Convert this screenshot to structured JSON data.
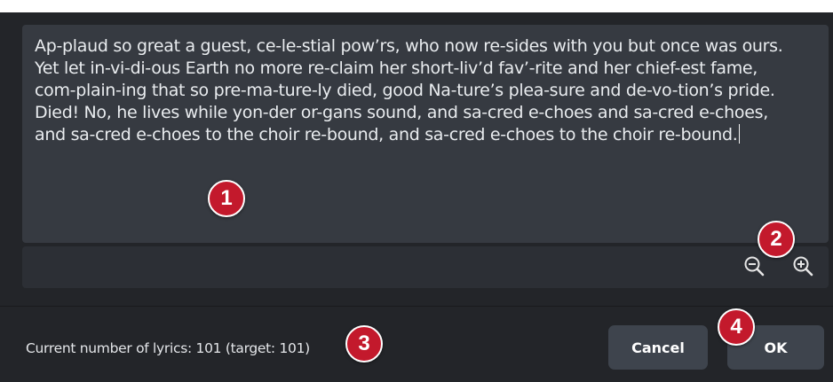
{
  "lyrics_editor": {
    "text": "Ap-plaud so great a guest, ce-le-stial pow’rs, who now re-sides with you but once was ours.\nYet let in-vi-di-ous Earth no more re-claim her short-liv’d fav’-rite and her chief-est fame,\ncom-plain-ing that so pre-ma-ture-ly died, good Na-ture’s plea-sure and de-vo-tion’s pride.\nDied! No, he lives while yon-der or-gans sound, and sa-cred e-choes and sa-cred e-choes,\nand sa-cred e-choes to the choir re-bound, and sa-cred e-choes to the choir re-bound."
  },
  "zoom_controls": {
    "zoom_out_icon": "zoom-out-icon",
    "zoom_in_icon": "zoom-in-icon"
  },
  "status": {
    "text": "Current number of lyrics: 101 (target: 101)"
  },
  "buttons": {
    "cancel_label": "Cancel",
    "ok_label": "OK"
  },
  "callouts": [
    "1",
    "2",
    "3",
    "4"
  ],
  "colors": {
    "background": "#232529",
    "editor_bg": "#363a41",
    "zoom_bar_bg": "#2c2f35",
    "button_bg": "#3e444d",
    "callout_red": "#c3192c"
  }
}
